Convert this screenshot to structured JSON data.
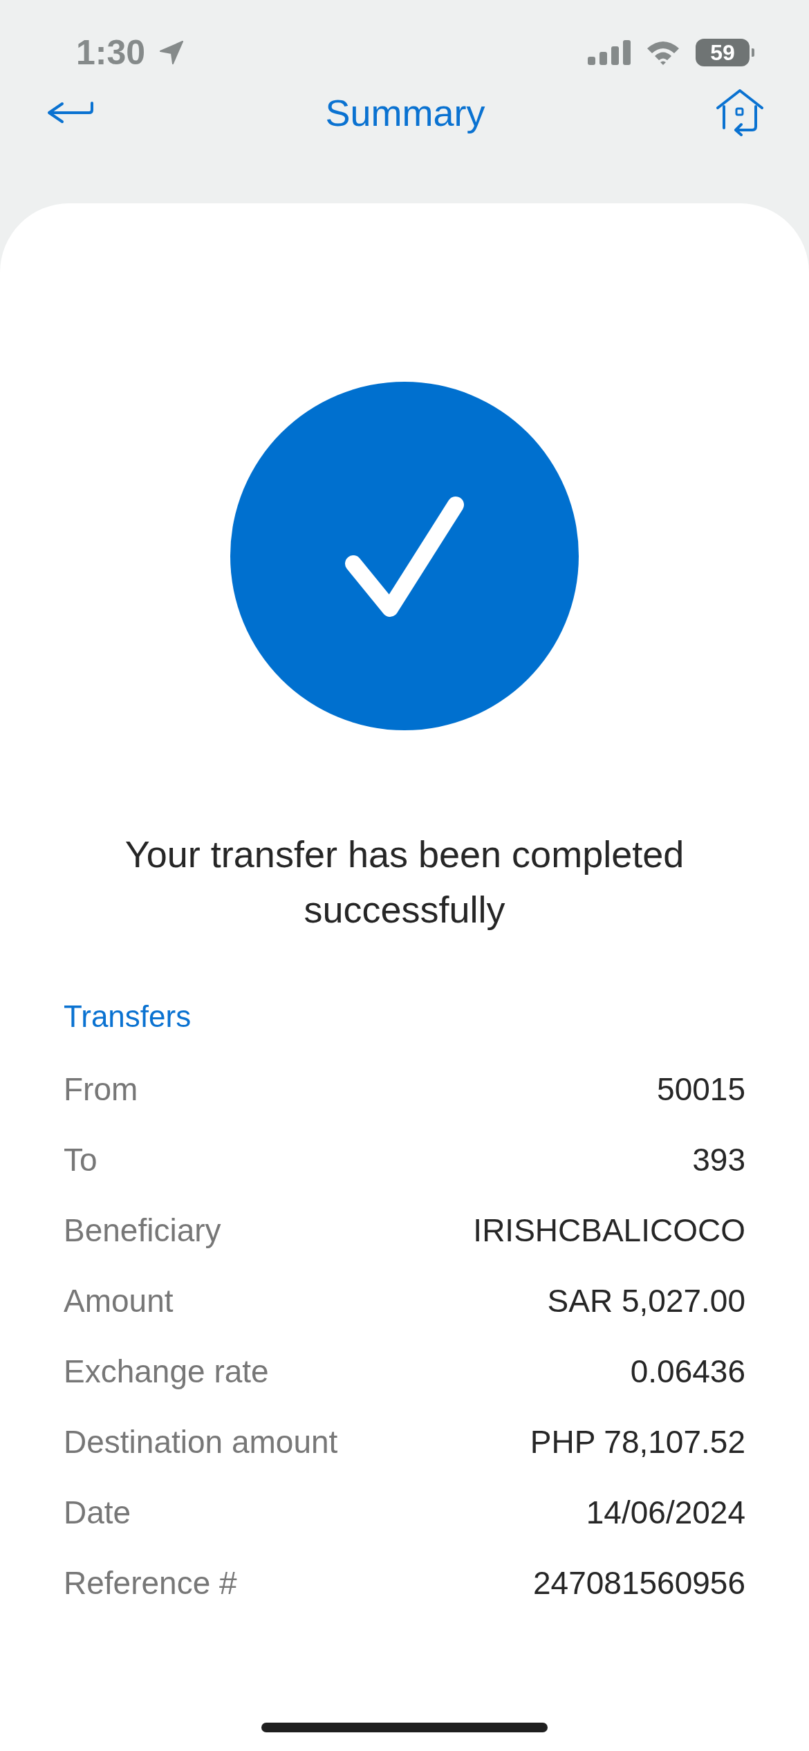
{
  "status_bar": {
    "time": "1:30",
    "battery": "59"
  },
  "header": {
    "title": "Summary"
  },
  "result": {
    "message": "Your transfer has been completed successfully"
  },
  "details": {
    "title": "Transfers",
    "rows": [
      {
        "label": "From",
        "value": "50015"
      },
      {
        "label": "To",
        "value": "393"
      },
      {
        "label": "Beneficiary",
        "value": "IRISHCBALICOCO"
      },
      {
        "label": "Amount",
        "value": "SAR 5,027.00"
      },
      {
        "label": "Exchange rate",
        "value": "0.06436"
      },
      {
        "label": "Destination amount",
        "value": "PHP 78,107.52"
      },
      {
        "label": "Date",
        "value": "14/06/2024"
      },
      {
        "label": "Reference #",
        "value": "247081560956"
      }
    ]
  }
}
